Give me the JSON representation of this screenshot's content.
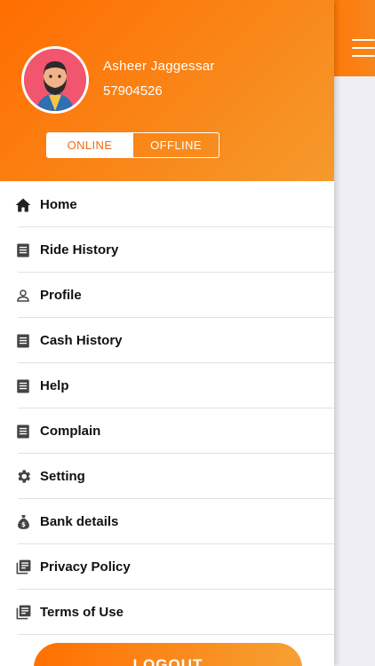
{
  "profile": {
    "name": "Asheer Jaggessar",
    "phone": "57904526"
  },
  "status": {
    "online_label": "ONLINE",
    "offline_label": "OFFLINE",
    "selected": "ONLINE"
  },
  "menu": [
    {
      "label": "Home",
      "icon": "home-icon"
    },
    {
      "label": "Ride History",
      "icon": "list-icon"
    },
    {
      "label": "Profile",
      "icon": "person-icon"
    },
    {
      "label": "Cash History",
      "icon": "list-icon"
    },
    {
      "label": "Help",
      "icon": "list-icon"
    },
    {
      "label": "Complain",
      "icon": "list-icon"
    },
    {
      "label": "Setting",
      "icon": "gear-icon"
    },
    {
      "label": "Bank details",
      "icon": "money-bag-icon"
    },
    {
      "label": "Privacy Policy",
      "icon": "library-books-icon"
    },
    {
      "label": "Terms of Use",
      "icon": "library-books-icon"
    }
  ],
  "logout": {
    "label": "LOGOUT"
  },
  "colors": {
    "accent": "#ff7a0a",
    "accent_light": "#f59a2c"
  }
}
